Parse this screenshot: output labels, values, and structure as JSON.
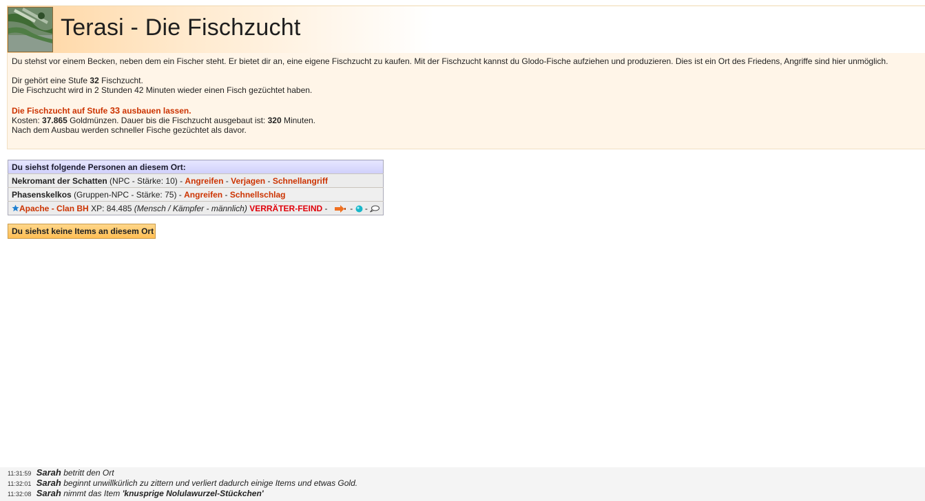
{
  "place": {
    "title": "Terasi - Die Fischzucht",
    "image_icon": "fish-pond-image"
  },
  "description": {
    "intro": "Du stehst vor einem Becken, neben dem ein Fischer steht. Er bietet dir an, eine eigene Fischzucht zu kaufen. Mit der Fischzucht kannst du Glodo-Fische aufziehen und produzieren. Dies ist ein Ort des Friedens, Angriffe sind hier unmöglich.",
    "level_prefix": "Dir gehört eine Stufe",
    "level": "32",
    "level_suffix": "Fischzucht.",
    "timer_text": "Die Fischzucht wird in 2 Stunden 42 Minuten wieder einen Fisch gezüchtet haben.",
    "upgrade_prefix": "Die Fischzucht auf Stufe",
    "upgrade_level": "33",
    "upgrade_suffix": "ausbauen lassen.",
    "cost_prefix": "Kosten:",
    "cost_value": "37.865",
    "cost_mid": "Goldmünzen. Dauer bis die Fischzucht ausgebaut ist:",
    "duration_value": "320",
    "duration_suffix": "Minuten.",
    "after_text": "Nach dem Ausbau werden schneller Fische gezüchtet als davor."
  },
  "persons": {
    "header": "Du siehst folgende Personen an diesem Ort:",
    "rows": [
      {
        "name": "Nekromant der Schatten",
        "info": "(NPC - Stärke: 10)",
        "actions": [
          "Angreifen",
          "Verjagen",
          "Schnellangriff"
        ]
      },
      {
        "name": "Phasenskelkos",
        "info": "(Gruppen-NPC - Stärke: 75)",
        "actions": [
          "Angreifen",
          "Schnellschlag"
        ]
      }
    ],
    "player": {
      "name": "Apache",
      "clan": "Clan BH",
      "xp_label": "XP:",
      "xp": "84.485",
      "race": "(Mensch / Kämpfer - männlich)",
      "status": "VERRÄTER-FEIND",
      "icons": [
        "star-icon",
        "send-icon",
        "online-dot-icon",
        "message-icon"
      ]
    }
  },
  "items": {
    "label": "Du siehst keine Items an diesem Ort"
  },
  "log": [
    {
      "time": "11:31:59",
      "name": "Sarah",
      "text": "betritt den Ort"
    },
    {
      "time": "11:32:01",
      "name": "Sarah",
      "text": "beginnt unwillkürlich zu zittern und verliert dadurch einige Items und etwas Gold."
    },
    {
      "time": "11:32:08",
      "name": "Sarah",
      "text": "nimmt das Item",
      "item": "'knusprige Nolulawurzel-Stückchen'"
    }
  ],
  "colors": {
    "link": "#cc3300",
    "enemy": "#e0000a",
    "header_gradient": "#ffd49e",
    "persons_header": "#cfcffa",
    "items_box": "#ffbf55"
  }
}
